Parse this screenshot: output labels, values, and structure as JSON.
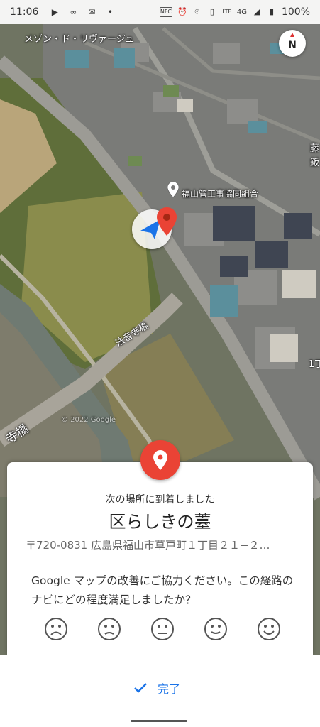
{
  "statusbar": {
    "time": "11:06",
    "network": "4G",
    "battery": "100%",
    "left_icons": [
      "play-icon",
      "voicemail-icon",
      "mail-icon",
      "dot-icon"
    ],
    "right_icons": [
      "nfc-icon",
      "alarm-icon",
      "location-icon",
      "vibrate-icon",
      "volte-icon",
      "signal-icon",
      "battery-icon"
    ]
  },
  "map": {
    "labels": {
      "top_left": "メゾン・ド・リヴァージュ",
      "poi": "福山管工事協同組合",
      "bridge": "法音寺橋",
      "bridge_left": "寺橋",
      "right_top": "藤\n鈑",
      "right_mid": "1丁"
    },
    "watermark": "© 2022 Google",
    "compass_label": "N",
    "colors": {
      "accent": "#ea4335",
      "nav_arrow": "#1a73e8"
    }
  },
  "card": {
    "arrived_text": "次の場所に到着しました",
    "place_name": "区らしきの薹",
    "address": "〒720-0831 広島県福山市草戸町１丁目２１−２…",
    "feedback": "Google マップの改善にご協力ください。この経路のナビにどの程度満足しましたか？",
    "ratings": [
      "very-dissatisfied",
      "dissatisfied",
      "neutral",
      "satisfied",
      "very-satisfied"
    ]
  },
  "bottombar": {
    "done_label": "完了"
  }
}
